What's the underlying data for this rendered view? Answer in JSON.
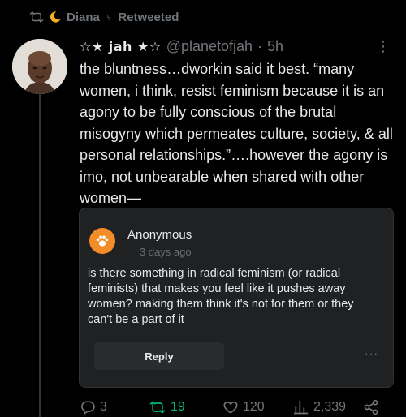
{
  "retweet": {
    "name": "Diana",
    "label": "Retweeted"
  },
  "tweet": {
    "display_name": "☆★ jah ★☆",
    "handle": "@planetofjah",
    "separator": "·",
    "time": "5h",
    "text": "the bluntness…dworkin said it best. “many women, i think, resist feminism because it is an agony to be fully conscious of the brutal misogyny which permeates culture, society, & all personal relationships.”….however the agony is imo, not unbearable when shared with other women—"
  },
  "card": {
    "author": "Anonymous",
    "time": "3 days ago",
    "question": "is there something in radical feminism (or radical feminists) that makes you feel like it pushes away women? making them think it's not for them or they can't be a part of it",
    "reply_label": "Reply"
  },
  "actions": {
    "replies": "3",
    "retweets": "19",
    "likes": "120",
    "views": "2,339"
  },
  "colors": {
    "background": "#000000",
    "text": "#e7e9ea",
    "muted": "#71767b",
    "retweet_green": "#00ba7c",
    "card_bg": "#202123",
    "anon_orange": "#f28c28"
  }
}
